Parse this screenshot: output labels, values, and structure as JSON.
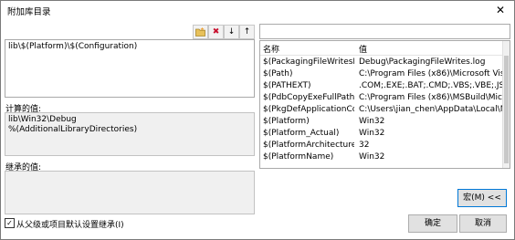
{
  "window": {
    "title": "附加库目录",
    "close_glyph": "✕"
  },
  "toolbar": {
    "new_folder_icon": "new-folder-icon",
    "delete_glyph": "✖",
    "down_glyph": "↓",
    "up_glyph": "↑"
  },
  "editor": {
    "value": "lib\\$(Platform)\\$(Configuration)"
  },
  "evaluated": {
    "label": "计算的值:",
    "lines": [
      "lib\\Win32\\Debug",
      "%(AdditionalLibraryDirectories)"
    ]
  },
  "inherited": {
    "label": "继承的值:"
  },
  "inherit_checkbox": {
    "checked": true,
    "label": "从父级或项目默认设置继承(I)"
  },
  "macros": {
    "filter_value": "",
    "columns": [
      "名称",
      "值"
    ],
    "rows": [
      {
        "name": "$(PackagingFileWritesLo...",
        "value": "Debug\\PackagingFileWrites.log"
      },
      {
        "name": "$(Path)",
        "value": "C:\\Program Files (x86)\\Microsoft Visual S"
      },
      {
        "name": "$(PATHEXT)",
        "value": ".COM;.EXE;.BAT;.CMD;.VBS;.VBE;.JS;.JSE;."
      },
      {
        "name": "$(PdbCopyExeFullPath)",
        "value": "C:\\Program Files (x86)\\MSBuild\\Microso"
      },
      {
        "name": "$(PkgDefApplicationCon...",
        "value": "C:\\Users\\jian_chen\\AppData\\Local\\Micro"
      },
      {
        "name": "$(Platform)",
        "value": "Win32"
      },
      {
        "name": "$(Platform_Actual)",
        "value": "Win32"
      },
      {
        "name": "$(PlatformArchitecture)",
        "value": "32"
      },
      {
        "name": "$(PlatformName)",
        "value": "Win32"
      }
    ]
  },
  "buttons": {
    "macros": "宏(M) <<",
    "ok": "确定",
    "cancel": "取消"
  }
}
